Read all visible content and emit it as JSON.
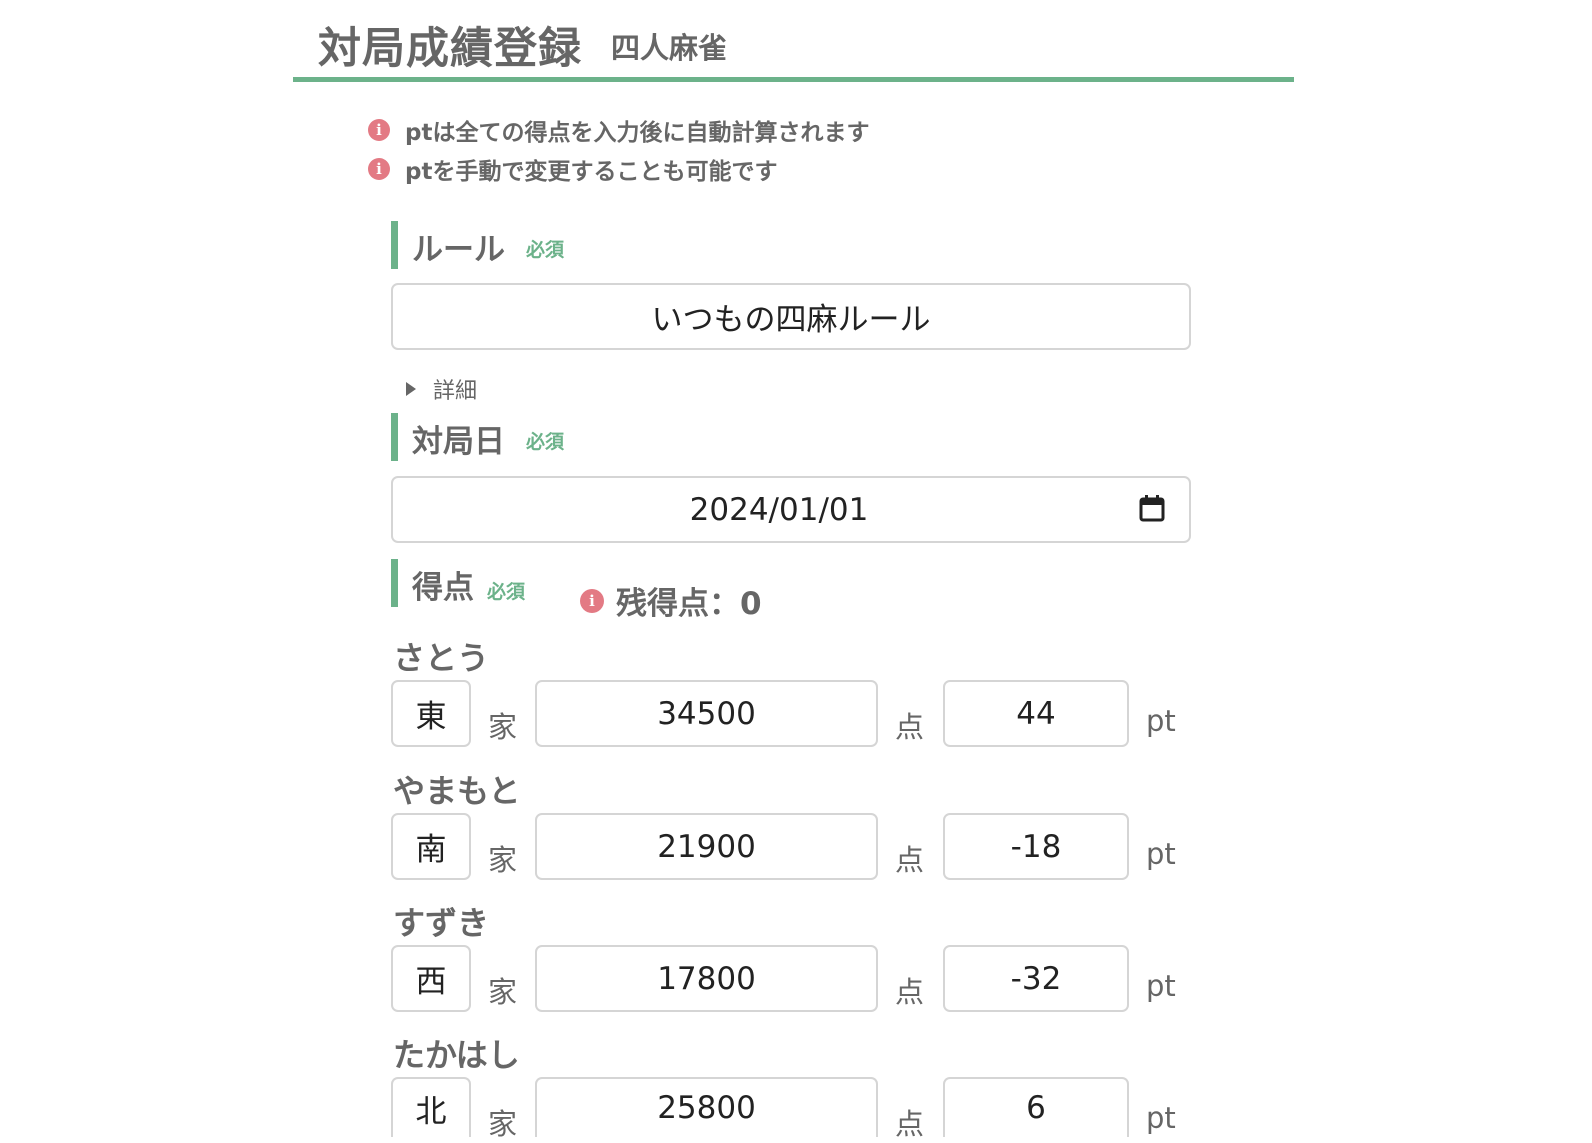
{
  "header": {
    "title": "対局成績登録",
    "subtitle": "四人麻雀"
  },
  "notices": [
    "ptは全ての得点を入力後に自動計算されます",
    "ptを手動で変更することも可能です"
  ],
  "required_label": "必須",
  "rule": {
    "label": "ルール",
    "value": "いつもの四麻ルール",
    "details_label": "詳細"
  },
  "date": {
    "label": "対局日",
    "value": "2024/01/01"
  },
  "score": {
    "label": "得点",
    "remaining_label": "残得点：0"
  },
  "units": {
    "seat_suffix": "家",
    "score_suffix": "点",
    "pt_suffix": "pt"
  },
  "players": [
    {
      "name": "さとう",
      "seat": "東",
      "score": "34500",
      "pt": "44"
    },
    {
      "name": "やまもと",
      "seat": "南",
      "score": "21900",
      "pt": "-18"
    },
    {
      "name": "すずき",
      "seat": "西",
      "score": "17800",
      "pt": "-32"
    },
    {
      "name": "たかはし",
      "seat": "北",
      "score": "25800",
      "pt": "6"
    }
  ],
  "colors": {
    "accent": "#6cb28a",
    "info": "#e37a84",
    "text": "#666666"
  },
  "icons": {
    "info": "info-circle-icon",
    "calendar": "calendar-icon",
    "disclosure": "triangle-right-icon"
  }
}
